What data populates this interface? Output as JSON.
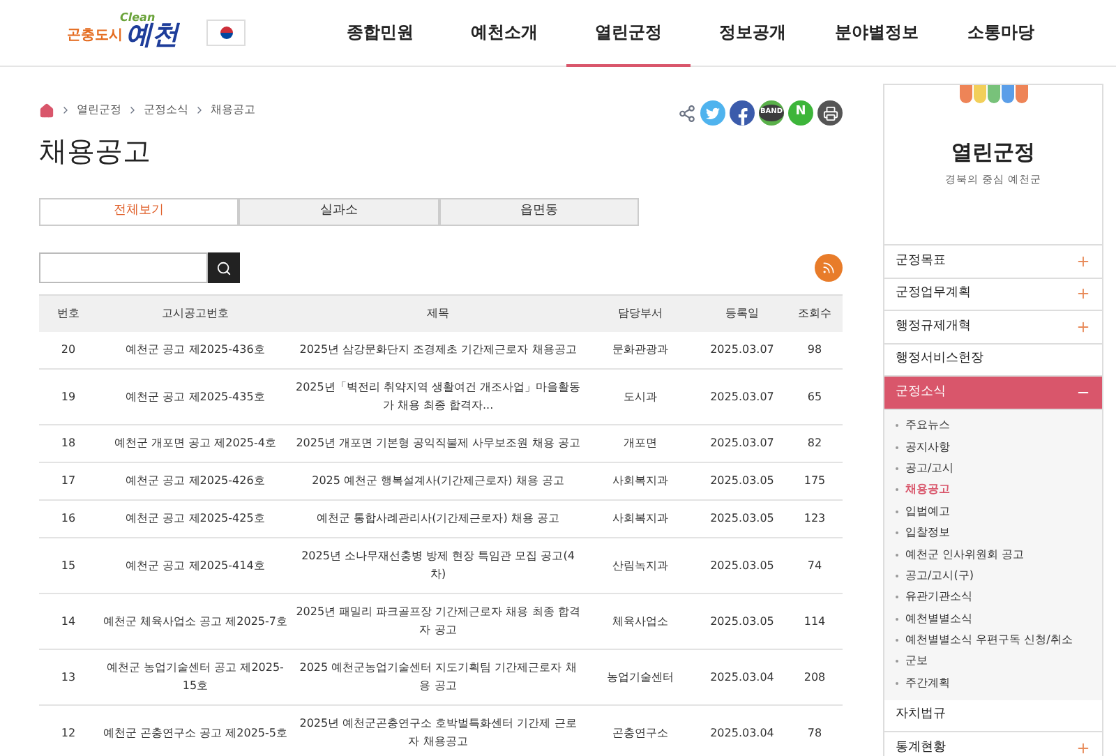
{
  "header": {
    "logo_tagline": "곤충도시",
    "logo_clean": "Clean",
    "logo_name": "예천",
    "nav": [
      {
        "label": "종합민원",
        "selected": false
      },
      {
        "label": "예천소개",
        "selected": false
      },
      {
        "label": "열린군정",
        "selected": true
      },
      {
        "label": "정보공개",
        "selected": false
      },
      {
        "label": "분야별정보",
        "selected": false
      },
      {
        "label": "소통마당",
        "selected": false
      }
    ]
  },
  "breadcrumb": [
    "열린군정",
    "군정소식",
    "채용공고"
  ],
  "page_title": "채용공고",
  "share": [
    {
      "kind": "share"
    },
    {
      "kind": "twitter"
    },
    {
      "kind": "facebook"
    },
    {
      "kind": "band",
      "label": "BAND"
    },
    {
      "kind": "naver",
      "label": "N"
    },
    {
      "kind": "print"
    }
  ],
  "tabs": [
    {
      "label": "전체보기",
      "selected": true
    },
    {
      "label": "실과소",
      "selected": false
    },
    {
      "label": "읍면동",
      "selected": false
    }
  ],
  "table": {
    "columns": [
      "번호",
      "고시공고번호",
      "제목",
      "담당부서",
      "등록일",
      "조회수"
    ],
    "rows": [
      [
        "20",
        "예천군 공고 제2025-436호",
        "2025년 삼강문화단지 조경제초 기간제근로자 채용공고",
        "문화관광과",
        "2025.03.07",
        "98"
      ],
      [
        "19",
        "예천군 공고 제2025-435호",
        "2025년「벽전리 취약지역 생활여건 개조사업」마을활동가 채용 최종 합격자...",
        "도시과",
        "2025.03.07",
        "65"
      ],
      [
        "18",
        "예천군 개포면 공고 제2025-4호",
        "2025년 개포면 기본형 공익직불제 사무보조원 채용 공고",
        "개포면",
        "2025.03.07",
        "82"
      ],
      [
        "17",
        "예천군 공고 제2025-426호",
        "2025 예천군 행복설계사(기간제근로자) 채용 공고",
        "사회복지과",
        "2025.03.05",
        "175"
      ],
      [
        "16",
        "예천군 공고 제2025-425호",
        "예천군 통합사례관리사(기간제근로자) 채용 공고",
        "사회복지과",
        "2025.03.05",
        "123"
      ],
      [
        "15",
        "예천군 공고 제2025-414호",
        "2025년 소나무재선충병 방제 현장 특임관 모집 공고(4차)",
        "산림녹지과",
        "2025.03.05",
        "74"
      ],
      [
        "14",
        "예천군 체육사업소 공고 제2025-7호",
        "2025년 패밀리 파크골프장 기간제근로자 채용 최종 합격자 공고",
        "체육사업소",
        "2025.03.05",
        "114"
      ],
      [
        "13",
        "예천군 농업기술센터 공고 제2025-15호",
        "2025 예천군농업기술센터 지도기획팀 기간제근로자 채용 공고",
        "농업기술센터",
        "2025.03.04",
        "208"
      ],
      [
        "12",
        "예천군 곤충연구소 공고 제2025-5호",
        "2025년 예천군곤충연구소 호박벌특화센터 기간제 근로자 채용공고",
        "곤충연구소",
        "2025.03.04",
        "78"
      ]
    ]
  },
  "sidebar": {
    "title": "열린군정",
    "subtitle": "경북의 중심 예천군",
    "items": [
      {
        "label": "군정목표",
        "expandable": true,
        "expanded": false
      },
      {
        "label": "군정업무계획",
        "expandable": true,
        "expanded": false
      },
      {
        "label": "행정규제개혁",
        "expandable": true,
        "expanded": false
      },
      {
        "label": "행정서비스헌장",
        "expandable": false,
        "expanded": false
      },
      {
        "label": "군정소식",
        "expandable": true,
        "expanded": true,
        "children": [
          {
            "label": "주요뉴스",
            "selected": false
          },
          {
            "label": "공지사항",
            "selected": false
          },
          {
            "label": "공고/고시",
            "selected": false
          },
          {
            "label": "채용공고",
            "selected": true
          },
          {
            "label": "입법예고",
            "selected": false
          },
          {
            "label": "입찰정보",
            "selected": false
          },
          {
            "label": "예천군 인사위원회 공고",
            "selected": false
          },
          {
            "label": "공고/고시(구)",
            "selected": false
          },
          {
            "label": "유관기관소식",
            "selected": false
          },
          {
            "label": "예천별별소식",
            "selected": false
          },
          {
            "label": "예천별별소식 우편구독 신청/취소",
            "selected": false
          },
          {
            "label": "군보",
            "selected": false
          },
          {
            "label": "주간계획",
            "selected": false
          }
        ]
      },
      {
        "label": "자치법규",
        "expandable": false,
        "expanded": false
      },
      {
        "label": "통계현황",
        "expandable": true,
        "expanded": false
      }
    ]
  }
}
